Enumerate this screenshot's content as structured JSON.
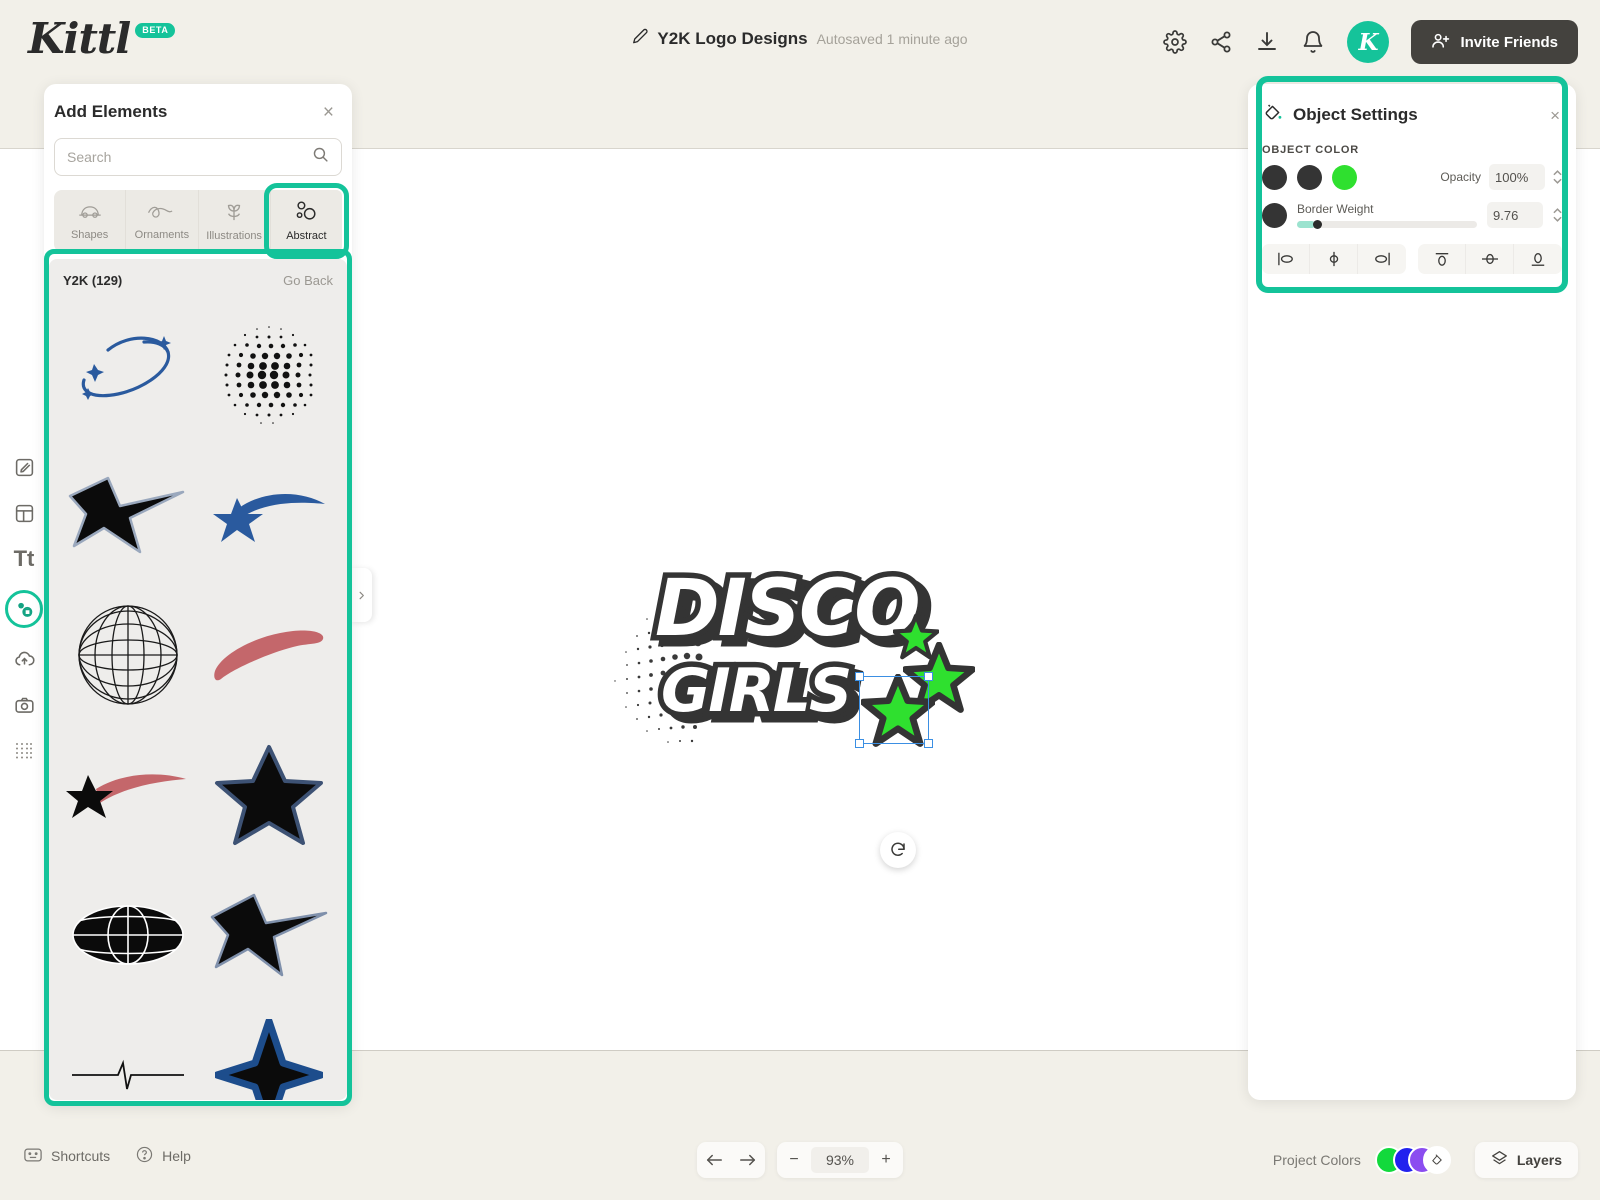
{
  "app": {
    "brand": "Kittl",
    "brand_badge": "BETA",
    "accent_color": "#14c39a",
    "dark_color": "#44423e"
  },
  "header": {
    "doc_title": "Y2K Logo Designs",
    "autosave_text": "Autosaved 1 minute ago",
    "icons": [
      {
        "name": "settings-icon",
        "label": "Settings"
      },
      {
        "name": "share-icon",
        "label": "Share"
      },
      {
        "name": "download-icon",
        "label": "Download"
      },
      {
        "name": "notifications-icon",
        "label": "Notifications"
      }
    ],
    "avatar_initial": "K",
    "invite_label": "Invite Friends"
  },
  "rail": {
    "items": [
      {
        "name": "sidebar-item-design",
        "label": "Design"
      },
      {
        "name": "sidebar-item-templates",
        "label": "Templates"
      },
      {
        "name": "sidebar-item-text",
        "label": "Text",
        "glyph": "Tt"
      },
      {
        "name": "sidebar-item-elements",
        "label": "Elements",
        "active": true
      },
      {
        "name": "sidebar-item-uploads",
        "label": "Uploads"
      },
      {
        "name": "sidebar-item-photos",
        "label": "Photos"
      },
      {
        "name": "sidebar-item-patterns",
        "label": "Patterns"
      }
    ]
  },
  "elements_panel": {
    "title": "Add Elements",
    "close_label": "×",
    "search": {
      "value": "",
      "placeholder": "Search"
    },
    "tabs": [
      {
        "label": "Shapes",
        "icon": "shapes-icon",
        "selected": false
      },
      {
        "label": "Ornaments",
        "icon": "ornaments-icon",
        "selected": false
      },
      {
        "label": "Illustrations",
        "icon": "illustrations-icon",
        "selected": false
      },
      {
        "label": "Abstract",
        "icon": "abstract-icon",
        "selected": true
      }
    ],
    "results_title": "Y2K (129)",
    "go_back_label": "Go Back",
    "items": [
      {
        "name": "element-orbit-swoosh-stars"
      },
      {
        "name": "element-halftone-circle"
      },
      {
        "name": "element-star-with-swoosh"
      },
      {
        "name": "element-blue-shooting-star"
      },
      {
        "name": "element-wireframe-globe"
      },
      {
        "name": "element-red-orbit-swoosh"
      },
      {
        "name": "element-star-red-trail"
      },
      {
        "name": "element-outlined-black-star"
      },
      {
        "name": "element-ellipse-globe"
      },
      {
        "name": "element-star-tail-outline"
      },
      {
        "name": "element-heartbeat-line"
      },
      {
        "name": "element-four-point-star"
      }
    ]
  },
  "object_settings": {
    "title": "Object Settings",
    "close_label": "×",
    "section_label": "OBJECT COLOR",
    "swatches": [
      "#343434",
      "#343434",
      "#2fe02f"
    ],
    "opacity_label": "Opacity",
    "opacity_value": "100%",
    "border_swatch": "#343434",
    "border_label": "Border Weight",
    "border_value": "9.76",
    "align_buttons": [
      {
        "name": "align-left-button",
        "label": "Align left"
      },
      {
        "name": "align-center-horizontal-button",
        "label": "Align center"
      },
      {
        "name": "align-right-button",
        "label": "Align right"
      },
      {
        "name": "align-top-button",
        "label": "Align top"
      },
      {
        "name": "align-middle-vertical-button",
        "label": "Align middle"
      },
      {
        "name": "align-bottom-button",
        "label": "Align bottom"
      }
    ]
  },
  "canvas": {
    "logo_line1": "DISCO",
    "logo_line2": "GIRLS",
    "logo_fill": "#ffffff",
    "logo_outline": "#343434",
    "star_color": "#2fe02f",
    "selection_color": "#3b8fe3",
    "rotate_label": "Rotate"
  },
  "footer": {
    "shortcuts_label": "Shortcuts",
    "help_label": "Help",
    "undo_label": "Undo",
    "redo_label": "Redo",
    "zoom_out_label": "−",
    "zoom_in_label": "+",
    "zoom_value": "93%",
    "project_colors_label": "Project Colors",
    "project_colors": [
      "#12d93c",
      "#2222ee",
      "#8b4df0"
    ],
    "layers_label": "Layers"
  }
}
